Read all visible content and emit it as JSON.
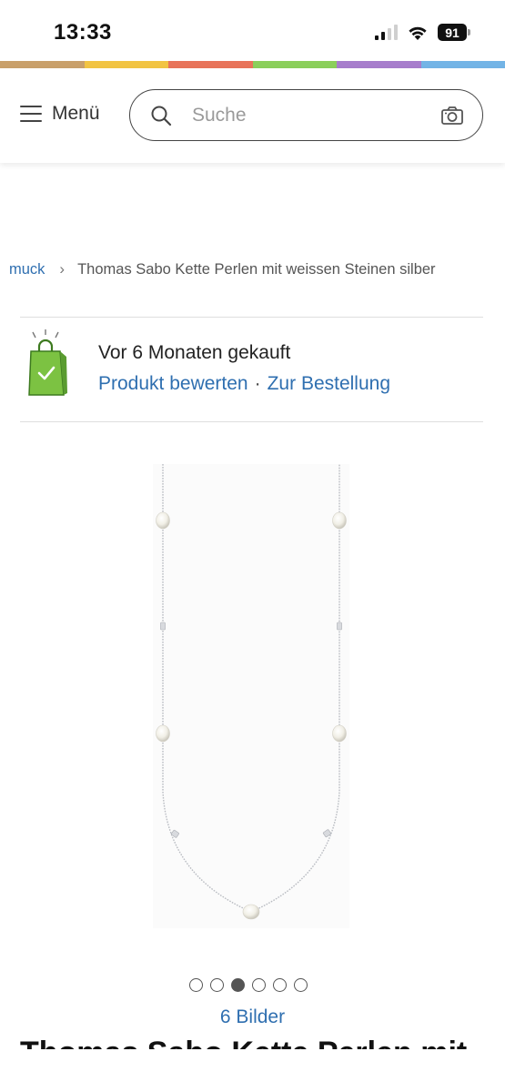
{
  "status_bar": {
    "time": "13:33",
    "battery": "91",
    "icons": [
      "signal-icon",
      "wifi-icon",
      "battery-icon"
    ]
  },
  "color_stripe": [
    "#c9a06b",
    "#f2c443",
    "#e8735a",
    "#8bcf5b",
    "#a77dcc",
    "#73b4e6"
  ],
  "header": {
    "menu_label": "Menü",
    "search_placeholder": "Suche",
    "icons": [
      "hamburger-icon",
      "search-icon",
      "camera-icon"
    ]
  },
  "breadcrumb": {
    "previous": "muck",
    "current": "Thomas Sabo Kette Perlen mit weissen Steinen silber"
  },
  "purchase_info": {
    "icon": "shopping-bag-check-icon",
    "purchased_text": "Vor 6 Monaten gekauft",
    "rate_link": "Produkt bewerten",
    "separator": "·",
    "order_link": "Zur Bestellung"
  },
  "gallery": {
    "image": "pearl-necklace-image",
    "dot_count": 6,
    "active_index": 2,
    "image_count_label": "6 Bilder"
  },
  "product": {
    "title": "Thomas Sabo Kette Perlen mit"
  },
  "colors": {
    "link": "#2f6fb0",
    "bag_green": "#7cc242"
  }
}
